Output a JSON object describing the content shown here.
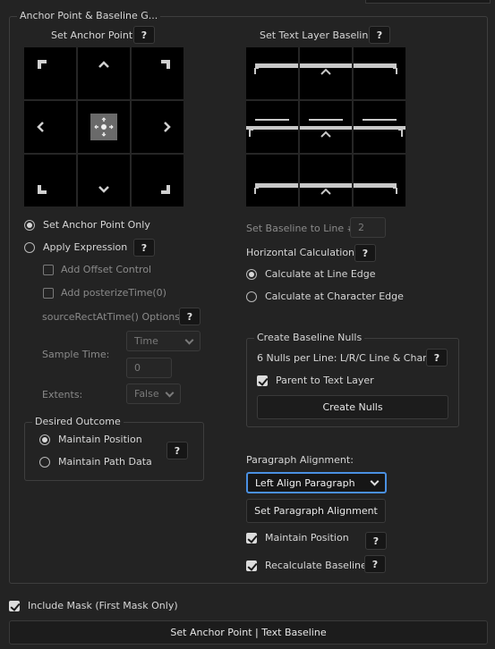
{
  "group_title": "Anchor Point & Baseline G...",
  "anchor": {
    "title": "Set Anchor Point",
    "help": "?",
    "opt_only": "Set Anchor Point Only",
    "opt_expr": "Apply Expression",
    "expr_help": "?",
    "add_offset": "Add Offset Control",
    "add_posterize": "Add posterizeTime(0)",
    "source_rect": "sourceRectAtTime() Options:",
    "source_help": "?",
    "sample_time_label": "Sample Time:",
    "sample_time_select": "Time",
    "sample_time_value": "0",
    "extents_label": "Extents:",
    "extents_select": "False",
    "desired_outcome": "Desired Outcome",
    "maintain_position": "Maintain Position",
    "maintain_path": "Maintain Path Data",
    "outcome_help": "?"
  },
  "baseline": {
    "title": "Set Text Layer Baseline",
    "help": "?",
    "line_label": "Set Baseline to Line #:",
    "line_value": "2",
    "horizontal_label": "Horizontal Calculation:",
    "horizontal_help": "?",
    "line_edge": "Calculate at Line Edge",
    "char_edge": "Calculate at Character Edge",
    "nulls_title": "Create Baseline Nulls",
    "nulls_desc": "6 Nulls per Line: L/R/C Line & Char",
    "nulls_help": "?",
    "parent_label": "Parent to Text Layer",
    "create_nulls": "Create Nulls",
    "para_label": "Paragraph Alignment:",
    "para_select": "Left Align Paragraph",
    "set_para": "Set Paragraph Alignment",
    "maintain_pos": "Maintain Position",
    "maintain_help": "?",
    "recalc": "Recalculate Baseline",
    "recalc_help": "?"
  },
  "include_mask": "Include Mask (First Mask Only)",
  "main_button": "Set Anchor Point | Text Baseline"
}
